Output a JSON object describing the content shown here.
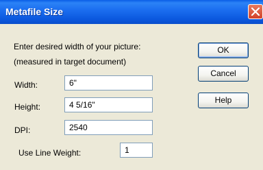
{
  "window": {
    "title": "Metafile Size"
  },
  "prompt": {
    "line1": "Enter desired width of your picture:",
    "line2": "(measured in target document)"
  },
  "fields": {
    "width": {
      "label": "Width:",
      "value": "6\""
    },
    "height": {
      "label": "Height:",
      "value": "4 5/16\""
    },
    "dpi": {
      "label": "DPI:",
      "value": "2540"
    },
    "line_weight": {
      "label": "Use Line Weight:",
      "value": "1"
    }
  },
  "buttons": {
    "ok": "OK",
    "cancel": "Cancel",
    "help": "Help"
  },
  "icons": {
    "close": "close-icon"
  },
  "colors": {
    "titlebar": "#0a5ee6",
    "close": "#d2422a",
    "face": "#ece9d8"
  }
}
